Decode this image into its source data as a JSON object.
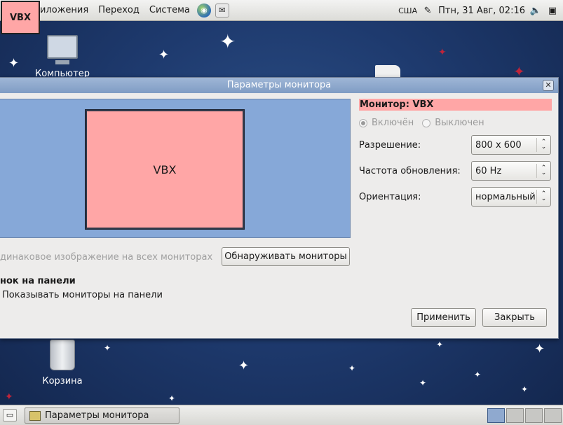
{
  "desktop": {
    "icons": {
      "computer": "Компьютер",
      "trash": "Корзина"
    }
  },
  "top_panel": {
    "menu": [
      "Приложения",
      "Переход",
      "Система"
    ],
    "menu_visible": [
      "иложения",
      "Переход",
      "Система"
    ],
    "keyboard_layout": "США",
    "clock": "Птн, 31 Авг, 02:16",
    "icons": [
      "browser-icon",
      "mail-icon",
      "edit-icon",
      "volume-icon",
      "network-icon"
    ]
  },
  "overlay_badge": "VBX",
  "dialog": {
    "title": "Параметры монитора",
    "monitor_preview_label": "VBX",
    "monitor_header": "Монитор: VBX",
    "radio_on": "Включён",
    "radio_off": "Выключен",
    "radio_selected": "on",
    "resolution_label": "Разрешение:",
    "resolution_value": "800 x 600",
    "refresh_label": "Частота обновления:",
    "refresh_value": "60 Hz",
    "rotation_label": "Ориентация:",
    "rotation_value": "нормальный",
    "mirror_label": "динаковое изображение на всех мониторах",
    "detect_button": "Обнаруживать мониторы",
    "panel_section_title": "нок на панели",
    "panel_checkbox_label": "Показывать мониторы на панели",
    "apply_button": "Применить",
    "close_button": "Закрыть"
  },
  "taskbar": {
    "task_label": "Параметры монитора",
    "workspace_count": 4,
    "active_workspace": 1
  },
  "colors": {
    "highlight": "#ffa6a6",
    "canvas": "#86a8d8",
    "titlebar": "#8fa9cf",
    "desktop": "#1e3a6e"
  }
}
